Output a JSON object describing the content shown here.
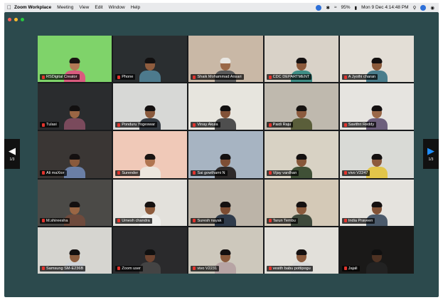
{
  "menubar": {
    "app_name": "Zoom Workplace",
    "menus": [
      "Meeting",
      "View",
      "Edit",
      "Window",
      "Help"
    ],
    "battery": "95%",
    "datetime": "Mon 9 Dec  4:14:48 PM"
  },
  "window": {
    "traffic_colors": [
      "#ff5f57",
      "#febc2e",
      "#28c840"
    ]
  },
  "paging": {
    "prev_page": "1/3",
    "next_page": "1/3"
  },
  "participants": [
    {
      "name": "RSDigital Creator",
      "bg": "#7fd36a",
      "skin": "#b37a56",
      "shirt": "#d95b7e",
      "hair": "#1a1412"
    },
    {
      "name": "Phone",
      "bg": "#2a2e30",
      "skin": "#8e5c3e",
      "shirt": "#4d7a8d",
      "hair": "#121010"
    },
    {
      "name": "Shaik Mohammad Ansari",
      "bg": "#c9b8a6",
      "skin": "#9a6848",
      "shirt": "#5b5b5b",
      "hair": "#e8e6e2"
    },
    {
      "name": "CDC DEPARTMENT",
      "bg": "#d9d2c8",
      "skin": "#8c5a3c",
      "shirt": "#3f8e86",
      "hair": "#141010"
    },
    {
      "name": "A Jyothi charan",
      "bg": "#e3ded6",
      "skin": "#8b5a3b",
      "shirt": "#4a7d8c",
      "hair": "#141010"
    },
    {
      "name": "Tulasi",
      "bg": "#2a2c2e",
      "skin": "#9a6644",
      "shirt": "#7a4a5c",
      "hair": "#121010"
    },
    {
      "name": "Ponduru Yogeswar",
      "bg": "#d7d8d6",
      "skin": "#8a5a3d",
      "shirt": "#363c44",
      "hair": "#141010"
    },
    {
      "name": "Vinay Akula",
      "bg": "#e7e5de",
      "skin": "#825238",
      "shirt": "#4e4e4e",
      "hair": "#121010"
    },
    {
      "name": "Paidi Raju",
      "bg": "#bfb9ae",
      "skin": "#8c5b3e",
      "shirt": "#5a5e3a",
      "hair": "#161210"
    },
    {
      "name": "Savithri Reddy",
      "bg": "#e6e4e0",
      "skin": "#9a6848",
      "shirt": "#6d5f7c",
      "hair": "#141010"
    },
    {
      "name": "Ali maXior",
      "bg": "#3a3634",
      "skin": "#8a5a3c",
      "shirt": "#6a7fa6",
      "hair": "#141010"
    },
    {
      "name": "Surender",
      "bg": "#f0c9b8",
      "skin": "#b07550",
      "shirt": "#ece6de",
      "hair": "#1a1412"
    },
    {
      "name": "Sai gowthami N",
      "bg": "#a7b4c2",
      "skin": "#7d4e35",
      "shirt": "#2e2a2a",
      "hair": "#141010"
    },
    {
      "name": "Vijay vardhan",
      "bg": "#d8d2c4",
      "skin": "#865739",
      "shirt": "#3f5036",
      "hair": "#141010"
    },
    {
      "name": "vivo V2247",
      "bg": "#d9dad6",
      "skin": "#8c5a3c",
      "shirt": "#e2c54a",
      "hair": "#141010"
    },
    {
      "name": "M.shireesha",
      "bg": "#4b4a47",
      "skin": "#9a6644",
      "shirt": "#6e4a3c",
      "hair": "#141010"
    },
    {
      "name": "Umesh chandra",
      "bg": "#e3e1dc",
      "skin": "#8e5c3d",
      "shirt": "#eeeeec",
      "hair": "#141010"
    },
    {
      "name": "Suresh nayak",
      "bg": "#bcb4a8",
      "skin": "#7c4c32",
      "shirt": "#2f3b4b",
      "hair": "#141010"
    },
    {
      "name": "Tarun Tembu",
      "bg": "#d4c9b7",
      "skin": "#8a5a3c",
      "shirt": "#3f4a3c",
      "hair": "#141010"
    },
    {
      "name": "India Praveen",
      "bg": "#e5e3de",
      "skin": "#825337",
      "shirt": "#4b5a6b",
      "hair": "#141010"
    },
    {
      "name": "Samsung SM-E236B",
      "bg": "#d6d5d0",
      "skin": "#8c5d3f",
      "shirt": "#cfd3d8",
      "hair": "#141010"
    },
    {
      "name": "Zoom user",
      "bg": "#2a2a2c",
      "skin": "#6e4430",
      "shirt": "#444",
      "hair": "#101010"
    },
    {
      "name": "vivo V2231",
      "bg": "#cdc8bc",
      "skin": "#8a5a3c",
      "shirt": "#b7a4a4",
      "hair": "#141010"
    },
    {
      "name": "vesith babu pottipogu",
      "bg": "#e2e0da",
      "skin": "#8a5a3c",
      "shirt": "#d8d8d8",
      "hair": "#141010"
    },
    {
      "name": "Jajali",
      "bg": "#1a1918",
      "skin": "#4e3223",
      "shirt": "#222",
      "hair": "#101010"
    }
  ]
}
